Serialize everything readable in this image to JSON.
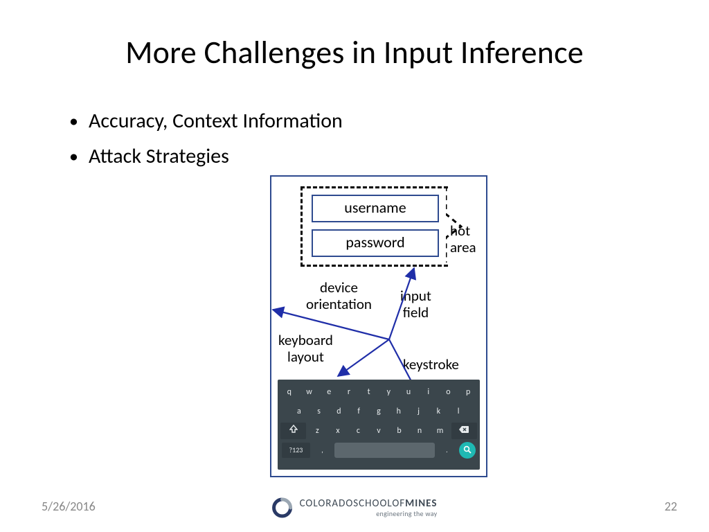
{
  "title": "More Challenges in Input Inference",
  "bullets": [
    "Accuracy, Context Information",
    "Attack Strategies"
  ],
  "footer": {
    "date": "5/26/2016",
    "page": "22",
    "org_part1": "COLORADO",
    "org_part2": "SCHOOLOF",
    "org_part3": "MINES",
    "org_tagline": "engineering the way"
  },
  "diagram": {
    "fields": {
      "username": "username",
      "password": "password"
    },
    "labels": {
      "hot_area_l1": "hot",
      "hot_area_l2": "area",
      "device_l1": "device",
      "device_l2": "orientation",
      "input_l1": "input",
      "input_l2": "field",
      "keyboard_l1": "keyboard",
      "keyboard_l2": "layout",
      "keystroke": "keystroke"
    },
    "keyboard": {
      "row1": [
        "q",
        "w",
        "e",
        "r",
        "t",
        "y",
        "u",
        "i",
        "o",
        "p"
      ],
      "row2": [
        "a",
        "s",
        "d",
        "f",
        "g",
        "h",
        "j",
        "k",
        "l"
      ],
      "row3_mid": [
        "z",
        "x",
        "c",
        "v",
        "b",
        "n",
        "m"
      ],
      "sym": "?123",
      "comma": ",",
      "period": "."
    }
  }
}
